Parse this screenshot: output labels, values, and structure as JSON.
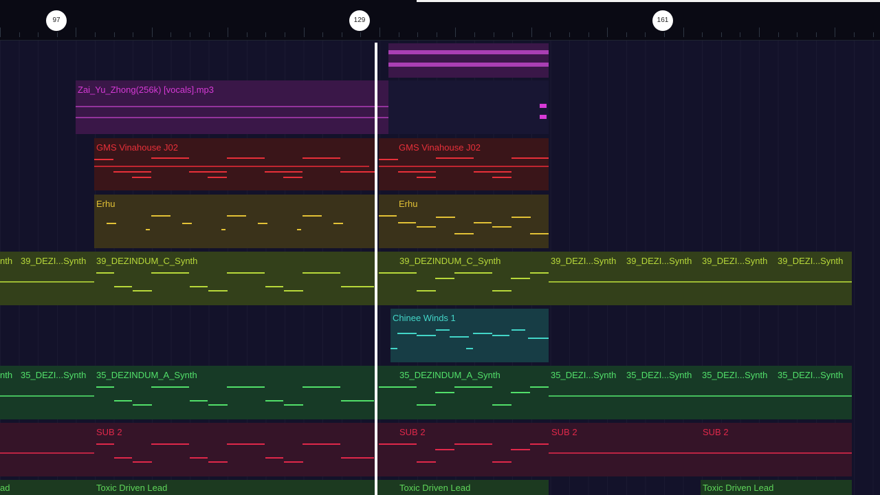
{
  "ruler": {
    "markers": [
      "97",
      "129",
      "161"
    ]
  },
  "tracks": {
    "vocals": {
      "label": "Zai_Yu_Zhong(256k) [vocals].mp3",
      "color": "#d63ad6"
    },
    "vinahouse": {
      "label": "GMS Vinahouse J02",
      "color": "#e8303a"
    },
    "erhu": {
      "label": "Erhu",
      "color": "#e3c236"
    },
    "synth39": {
      "label_full": "39_DEZINDUM_C_Synth",
      "label_short": "39_DEZI...Synth",
      "color": "#b8d93a"
    },
    "winds": {
      "label": "Chinee Winds 1",
      "color": "#43d6c8"
    },
    "synth35": {
      "label_full": "35_DEZINDUM_A_Synth",
      "label_short": "35_DEZI...Synth",
      "color": "#52e06a"
    },
    "sub": {
      "label": "SUB 2",
      "color": "#e0284a"
    },
    "lead": {
      "label": "Toxic Driven Lead",
      "label_cut": "ad",
      "color": "#5fd65a"
    }
  },
  "labels_cut": {
    "synth39": "nth",
    "synth35": "nth"
  }
}
